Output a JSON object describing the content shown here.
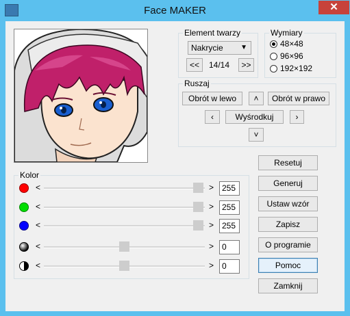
{
  "window": {
    "title": "Face MAKER",
    "close_glyph": "✕"
  },
  "element_group": {
    "legend": "Element twarzy",
    "select_value": "Nakrycie",
    "prev_label": "<<",
    "next_label": ">>",
    "counter": "14/14"
  },
  "size_group": {
    "legend": "Wymiary",
    "options": [
      {
        "label": "48×48",
        "selected": true
      },
      {
        "label": "96×96",
        "selected": false
      },
      {
        "label": "192×192",
        "selected": false
      }
    ]
  },
  "move_group": {
    "legend": "Ruszaj",
    "rotate_left": "Obrót w lewo",
    "up": "˄",
    "rotate_right": "Obrót w prawo",
    "left": "‹",
    "center": "Wyśrodkuj",
    "right": "›",
    "down": "˅"
  },
  "color_group": {
    "legend": "Kolor",
    "sliders": [
      {
        "name": "red",
        "value": "255",
        "level": 1.0,
        "swatch": "#ff0000"
      },
      {
        "name": "green",
        "value": "255",
        "level": 1.0,
        "swatch": "#00dd00"
      },
      {
        "name": "blue",
        "value": "255",
        "level": 1.0,
        "swatch": "#0000ff"
      },
      {
        "name": "brightness",
        "value": "0",
        "level": 0.5,
        "swatch": "gradient-black"
      },
      {
        "name": "contrast",
        "value": "0",
        "level": 0.5,
        "swatch": "half-black"
      }
    ],
    "left_arrow": "<",
    "right_arrow": ">"
  },
  "actions": {
    "reset": "Resetuj",
    "generate": "Generuj",
    "set_pattern": "Ustaw wzór",
    "save": "Zapisz",
    "about": "O programie",
    "help": "Pomoc",
    "close": "Zamknij"
  },
  "colors": {
    "titlebar": "#5bc0ee",
    "close": "#c7423a",
    "hair": "#c0206a",
    "eyes": "#1a5fd0"
  }
}
